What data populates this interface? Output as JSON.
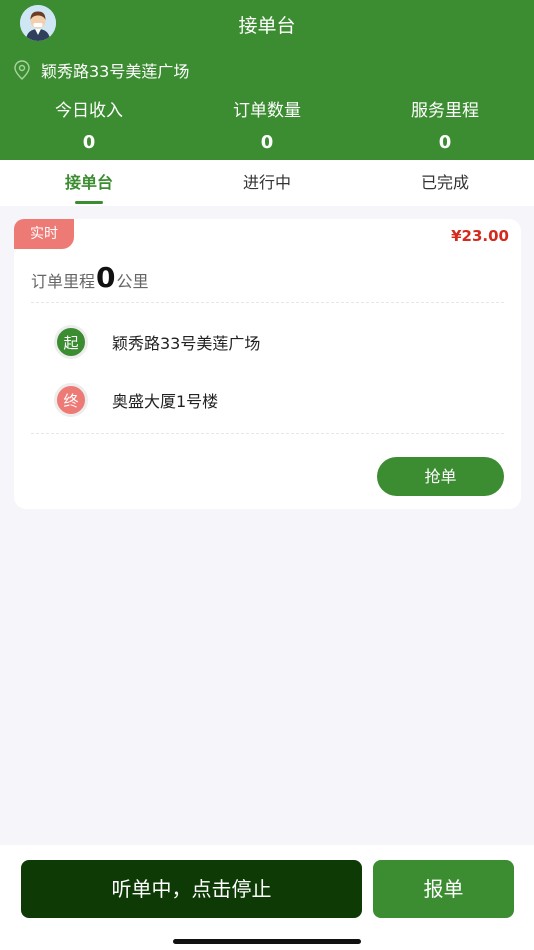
{
  "header": {
    "title": "接单台",
    "location": "颖秀路33号美莲广场",
    "stats": [
      {
        "label": "今日收入",
        "value": "0"
      },
      {
        "label": "订单数量",
        "value": "0"
      },
      {
        "label": "服务里程",
        "value": "0"
      }
    ]
  },
  "tabs": [
    {
      "label": "接单台",
      "active": true
    },
    {
      "label": "进行中",
      "active": false
    },
    {
      "label": "已完成",
      "active": false
    }
  ],
  "order": {
    "badge": "实时",
    "price": "¥23.00",
    "mileage_prefix": "订单里程",
    "mileage_value": "0",
    "mileage_unit": "公里",
    "start_marker": "起",
    "start_address": "颖秀路33号美莲广场",
    "end_marker": "终",
    "end_address": "奥盛大厦1号楼",
    "grab_label": "抢单"
  },
  "footer": {
    "listen_label": "听单中，点击停止",
    "report_label": "报单"
  },
  "colors": {
    "primary": "#3c8c32",
    "dark_primary": "#0e3a05",
    "accent_red": "#ee7a76",
    "price_red": "#d42a1e"
  },
  "icons": {
    "avatar": "avatar-icon",
    "location": "location-pin-icon"
  }
}
